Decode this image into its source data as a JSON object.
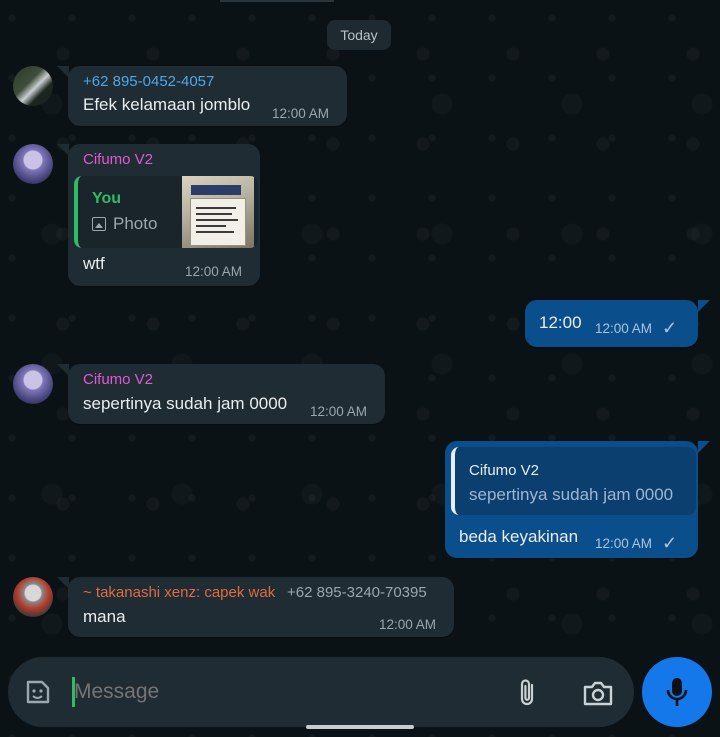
{
  "date_chip": "Today",
  "composer": {
    "placeholder": "Message"
  },
  "colors": {
    "incoming_bubble": "#1f2c33",
    "outgoing_bubble": "#0b4e8c",
    "mic_button": "#1477ea",
    "sender_phone": "#4fa7e6",
    "sender_cifumo": "#e05ad0",
    "sender_takanashi": "#e06b42"
  },
  "messages": [
    {
      "direction": "in",
      "sender": "+62 895-0452-4057",
      "text": "Efek kelamaan jomblo",
      "time": "12:00 AM",
      "avatar": "avatar-phone-user"
    },
    {
      "direction": "in",
      "sender": "Cifumo V2",
      "reply": {
        "author": "You",
        "media_label": "Photo",
        "media_icon": "photo-icon"
      },
      "text": "wtf",
      "time": "12:00 AM",
      "avatar": "avatar-anime-girl"
    },
    {
      "direction": "out",
      "text": "12:00",
      "time": "12:00 AM",
      "status": "sent-check"
    },
    {
      "direction": "in",
      "sender": "Cifumo V2",
      "text": "sepertinya sudah jam 0000",
      "time": "12:00 AM",
      "avatar": "avatar-anime-girl"
    },
    {
      "direction": "out",
      "reply": {
        "author": "Cifumo V2",
        "text": "sepertinya sudah jam 0000"
      },
      "text": "beda keyakinan",
      "time": "12:00 AM",
      "status": "sent-check"
    },
    {
      "direction": "in",
      "sender": "~ takanashi xenz: capek wak",
      "sender_phone": "+62 895-3240-70395",
      "text": "mana",
      "time": "12:00 AM",
      "avatar": "avatar-knight"
    }
  ]
}
